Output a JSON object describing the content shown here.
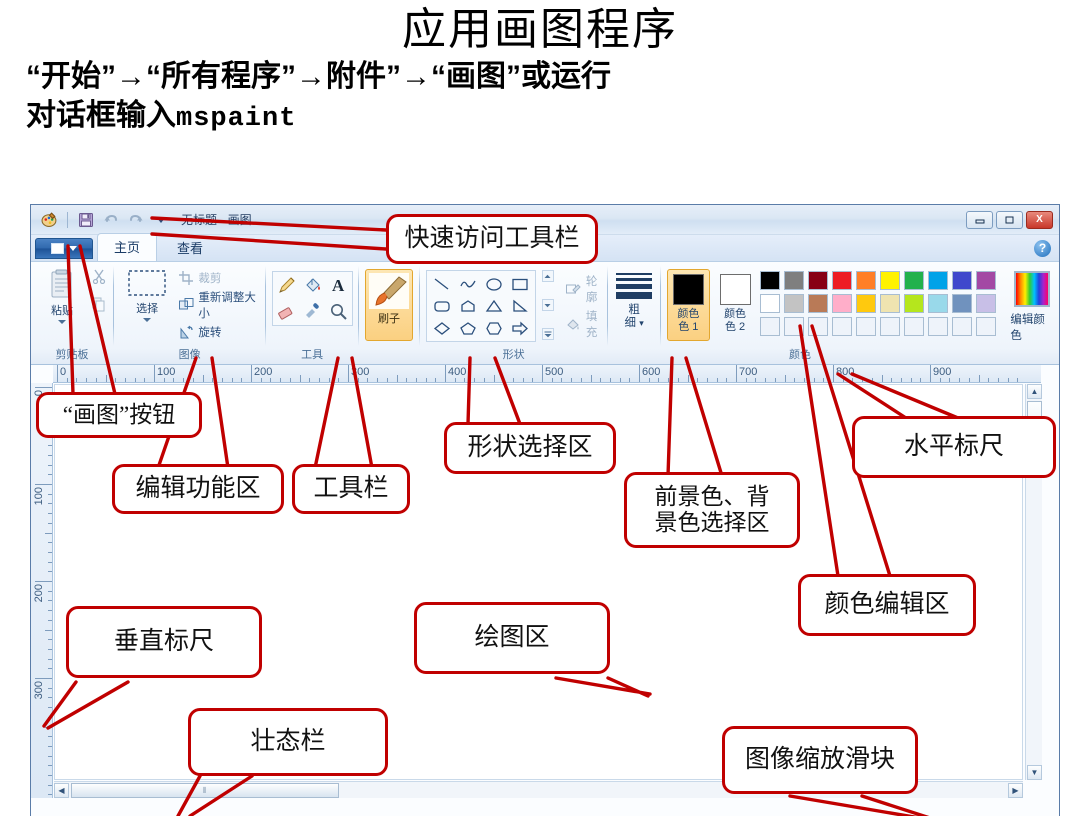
{
  "slide": {
    "title": "应用画图程序",
    "subtitle_line1": "“开始”→“所有程序”→附件”→“画图”或运行",
    "subtitle_line2_prefix": "对话框输入",
    "subtitle_line2_mono": "mspaint"
  },
  "paint": {
    "window_title": "无标题 - 画图",
    "quick_access": [
      {
        "name": "paint-menu-icon",
        "glyph": "palette"
      },
      {
        "name": "save-icon",
        "glyph": "floppy"
      },
      {
        "name": "undo-icon",
        "glyph": "undo"
      },
      {
        "name": "redo-icon",
        "glyph": "redo"
      },
      {
        "name": "customize-qat-icon",
        "glyph": "caret"
      }
    ],
    "window_controls": {
      "minimize": "—",
      "maximize": "□",
      "close": "X",
      "help": "?"
    },
    "paint_button_label": "",
    "tabs": [
      {
        "label": "主页",
        "active": true
      },
      {
        "label": "查看",
        "active": false
      }
    ],
    "groups": [
      {
        "label": "剪贴板"
      },
      {
        "label": "图像"
      },
      {
        "label": "工具"
      },
      {
        "label": "形状"
      },
      {
        "label": "颜色"
      }
    ],
    "clipboard": {
      "paste_label": "粘贴",
      "cut_name": "cut-icon",
      "copy_name": "copy-icon"
    },
    "image_group": {
      "select_label": "选择",
      "crop_label": "裁剪",
      "resize_label": "重新调整大小",
      "rotate_label": "旋转"
    },
    "tools": [
      {
        "name": "pencil-tool",
        "glyph": "pencil"
      },
      {
        "name": "fill-tool",
        "glyph": "bucket"
      },
      {
        "name": "text-tool",
        "glyph": "A"
      },
      {
        "name": "eraser-tool",
        "glyph": "eraser"
      },
      {
        "name": "color-picker-tool",
        "glyph": "dropper"
      },
      {
        "name": "magnifier-tool",
        "glyph": "magnifier"
      }
    ],
    "brush": {
      "label": "刷子",
      "selected": true
    },
    "shapes_group": {
      "outline_label": "轮廓",
      "fill_label": "填充",
      "shapes": [
        "line",
        "curve",
        "ellipse",
        "rectangle",
        "rounded-rectangle",
        "polygon",
        "triangle",
        "right-triangle",
        "diamond",
        "pentagon",
        "hexagon",
        "right-arrow"
      ]
    },
    "thickness": {
      "label_line1": "粗",
      "label_line2": "细"
    },
    "color1": {
      "label_line1": "颜色",
      "label_line2": "色 1",
      "value": "#000000",
      "selected": true
    },
    "color2": {
      "label_line1": "颜色",
      "label_line2": "色 2",
      "value": "#ffffff",
      "selected": false
    },
    "palette": {
      "edit_label": "编辑颜色",
      "row1": [
        "#000000",
        "#7f7f7f",
        "#880015",
        "#ed1c24",
        "#ff7f27",
        "#fff200",
        "#22b14c",
        "#00a2e8",
        "#3f48cc",
        "#a349a4"
      ],
      "row2": [
        "#ffffff",
        "#c3c3c3",
        "#b97a57",
        "#ffaec9",
        "#ffc90e",
        "#efe4b0",
        "#b5e61d",
        "#99d9ea",
        "#7092be",
        "#c8bfe7"
      ],
      "row3": [
        "#eef3fa",
        "#eef3fa",
        "#eef3fa",
        "#eef3fa",
        "#eef3fa",
        "#eef3fa",
        "#eef3fa",
        "#eef3fa",
        "#eef3fa",
        "#eef3fa"
      ]
    },
    "hruler_labels": [
      "0",
      "100",
      "200",
      "300",
      "400",
      "500",
      "600",
      "700",
      "800",
      "900"
    ],
    "vruler_labels": [
      "0",
      "100",
      "200",
      "300"
    ]
  },
  "annotations": [
    {
      "id": "quick-access-toolbar",
      "text": "快速访问工具栏"
    },
    {
      "id": "paint-button",
      "text": "“画图”按钮"
    },
    {
      "id": "edit-ribbon",
      "text": "编辑功能区"
    },
    {
      "id": "toolbar",
      "text": "工具栏"
    },
    {
      "id": "shape-select-area",
      "text": "形状选择区"
    },
    {
      "id": "fg-bg-color-area",
      "text": "前景色、背\n景色选择区"
    },
    {
      "id": "color-edit-area",
      "text": "颜色编辑区"
    },
    {
      "id": "horizontal-ruler",
      "text": "水平标尺"
    },
    {
      "id": "vertical-ruler",
      "text": "垂直标尺"
    },
    {
      "id": "drawing-area",
      "text": "绘图区"
    },
    {
      "id": "status-bar",
      "text": "壮态栏"
    },
    {
      "id": "zoom-slider",
      "text": "图像缩放滑块"
    }
  ]
}
